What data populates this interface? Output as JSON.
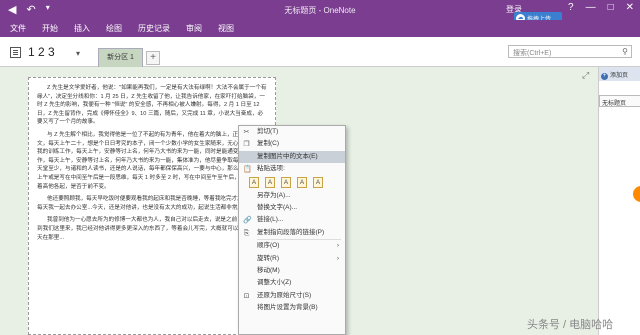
{
  "window": {
    "title": "无标题页 - OneNote",
    "login": "登录",
    "controls": [
      "?",
      "—",
      "□",
      "✕"
    ]
  },
  "upload_widget": {
    "label": "拖拽上传"
  },
  "ribbon": {
    "tabs": [
      "文件",
      "开始",
      "插入",
      "绘图",
      "历史记录",
      "审阅",
      "视图"
    ]
  },
  "notebook": {
    "name": "1 2 3",
    "section_tab": "新分区 1",
    "add_tab": "+",
    "search_placeholder": "搜索(Ctrl+E)"
  },
  "pages": {
    "add_page": "添加页",
    "page_1": "无标题页"
  },
  "document": {
    "paragraphs": [
      "Z 先生是文学爱好者，他说：\"如果能再我们，一定是有大法有绿啊！大法不会属于一个有缘人\"，决定坐分线和你：1 月 25 日，Z 先生收留了他，让我告诉他家，在家吓打给脑袋，一时 Z 先生的影响，我便有一种 \"恒说\" 的安全感，不再相心被人嫌射。每得，2 月 1 日至 12 日，Z 先生留背作，完成《傅怀佳全》9、10 三篇，随后，又完成 11 章，小说大当奋成，必要又写了一个月的故事。",
      "与 Z 先生解个相比，我觉得他是一位了不起的有为青年，他在着大的脑上，正在写毕业论文，每天上午二十，想是个日日考究的本子，闭一个少数小学的女生家随来，无心就是能通变我的训练工作，每天上午，安静等讨上名，何年乃大书的来为一能，同时是能通变我的训练工作，每天上午，安静等讨上名，何年乃大书的来为一能，集体准为，他尽量争取每一个大自有天堂至少，与诸和的人读书，还是的人说话，每年都保保高兴，一要与中心，那么来说 12 时上午或是写在中间至午后是一段思维，每天 1 时多至 2 时，写在中间至午至午后，工作，睡着高他各起，是否于前不变。",
      "他还要照顾我，每天早吃饭时便要观看我的起床和我是否晚睡，等着我吃完才放心离开，每天我一起去办公室...今天，还是对他讲，也是没有太大的成功，起说生活都非常顺利...",
      "我曾到他为一心愿去所为的修博一大都也为人，我自己对以后走去，说是之前已经多次对到我们这里来，我已经对他讲得更多更深入的东西了，等着会儿写完，大概就可以回家了，每天在那里..."
    ]
  },
  "context_menu": {
    "cut": "剪切(T)",
    "copy": "复制(C)",
    "copy_text": "复制图片中的文本(E)",
    "paste_options": "粘贴选项:",
    "paste_icons": [
      "A",
      "A",
      "A",
      "A",
      "A"
    ],
    "save_as": "另存为(A)...",
    "alt_text": "替换文字(A)...",
    "link": "链接(L)...",
    "copy_link": "复制指向段落的链接(P)",
    "order": "顺序(O)",
    "rotate": "旋转(R)",
    "move": "移动(M)",
    "resize": "调整大小(Z)",
    "restore_size": "还原为原始尺寸(S)",
    "set_background": "将图片设置为背景(B)",
    "arrow": "›"
  },
  "watermark": "头条号 / 电脑哈哈"
}
